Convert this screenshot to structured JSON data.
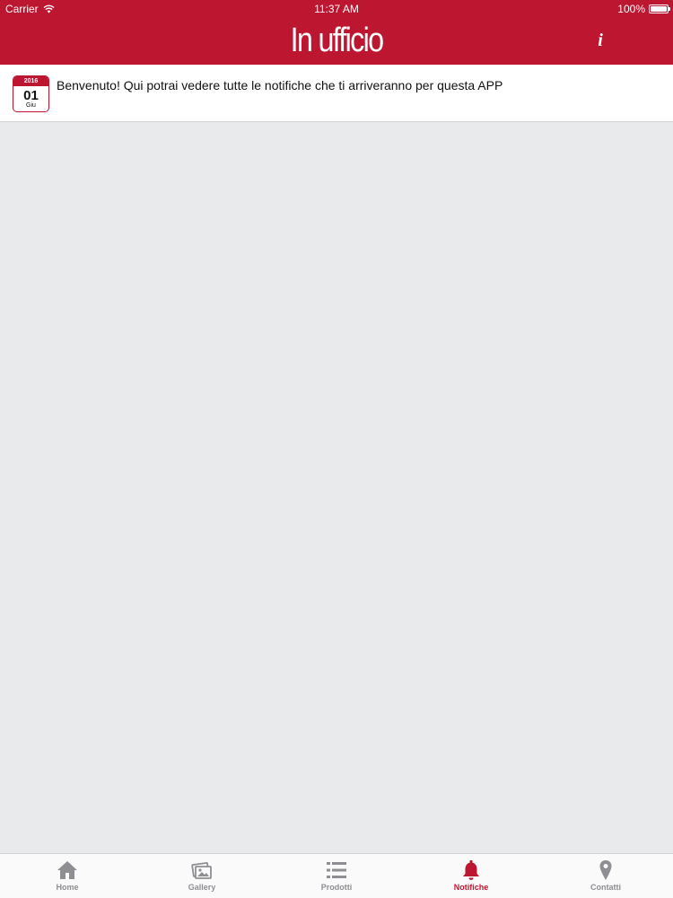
{
  "status_bar": {
    "carrier": "Carrier",
    "time": "11:37 AM",
    "battery": "100%",
    "battery_level": 1.0
  },
  "header": {
    "title": "In ufficio",
    "info_label": "i",
    "background_color": "#bd1631"
  },
  "notifications": [
    {
      "year": "2016",
      "day": "01",
      "month": "Giu",
      "message": "Benvenuto! Qui potrai vedere tutte le notifiche che ti arriveranno per questa APP"
    }
  ],
  "tabs": [
    {
      "label": "Home",
      "icon": "home-icon",
      "active": false
    },
    {
      "label": "Gallery",
      "icon": "gallery-icon",
      "active": false
    },
    {
      "label": "Prodotti",
      "icon": "list-icon",
      "active": false
    },
    {
      "label": "Notifiche",
      "icon": "bell-icon",
      "active": true
    },
    {
      "label": "Contatti",
      "icon": "map-pin-icon",
      "active": false
    }
  ],
  "colors": {
    "accent": "#bd1631",
    "inactive_tab": "#8e8e93",
    "content_background": "#e9eaeb"
  }
}
